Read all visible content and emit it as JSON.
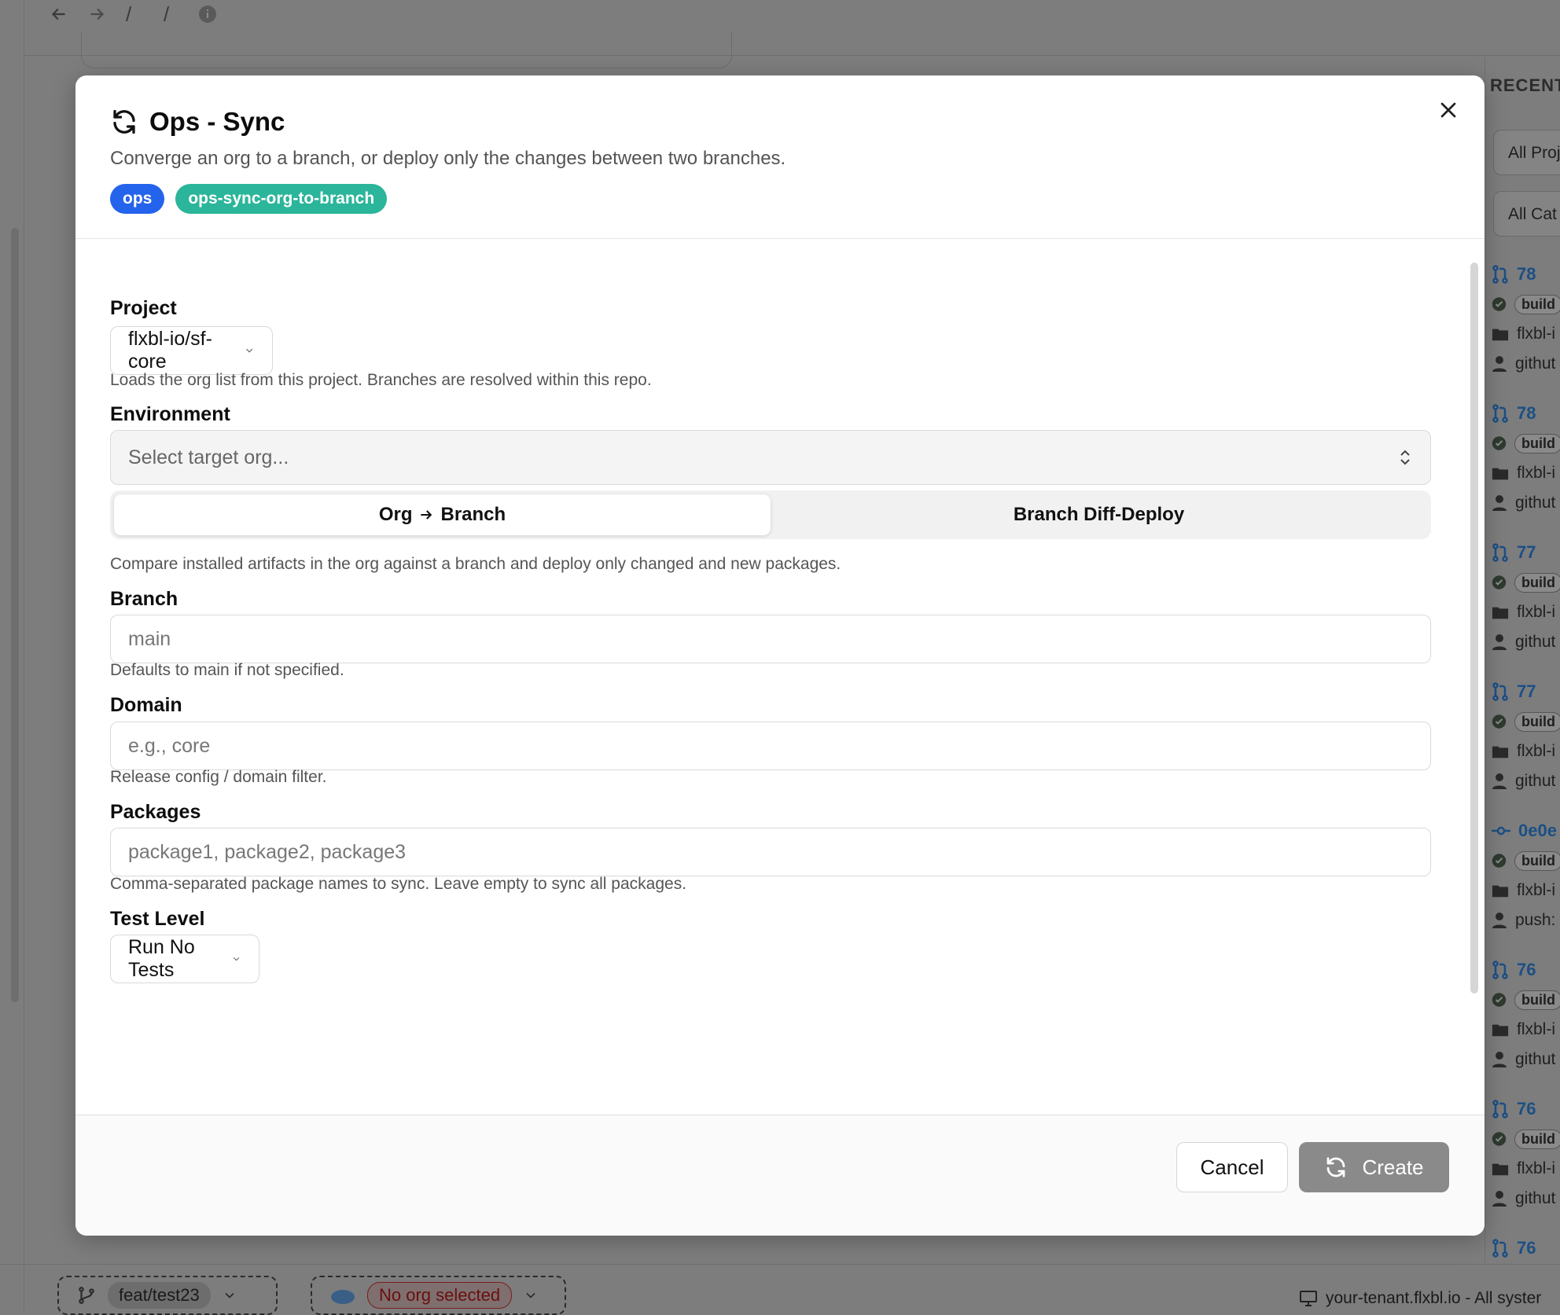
{
  "background": {
    "nav": {
      "back_icon": "arrow-left-icon",
      "forward_icon": "arrow-right-icon",
      "sep1": "/",
      "sep2": "/",
      "info_icon": "info-icon"
    },
    "right_panel": {
      "heading": "RECENT",
      "filter_projects": "All Proj",
      "filter_categories": "All Cat",
      "items": [
        {
          "number": "78",
          "badge": "build",
          "repo": "flxbl-i",
          "user": "githut",
          "kind": "pr"
        },
        {
          "number": "78",
          "badge": "build",
          "repo": "flxbl-i",
          "user": "githut",
          "kind": "pr"
        },
        {
          "number": "77",
          "badge": "build",
          "repo": "flxbl-i",
          "user": "githut",
          "kind": "pr"
        },
        {
          "number": "77",
          "badge": "build",
          "repo": "flxbl-i",
          "user": "githut",
          "kind": "pr"
        },
        {
          "number": "0e0e",
          "badge": "build",
          "repo": "flxbl-i",
          "user": "push:",
          "kind": "commit"
        },
        {
          "number": "76",
          "badge": "build",
          "repo": "flxbl-i",
          "user": "githut",
          "kind": "pr"
        },
        {
          "number": "76",
          "badge": "build",
          "repo": "flxbl-i",
          "user": "githut",
          "kind": "pr"
        },
        {
          "number": "76",
          "badge": "",
          "repo": "",
          "user": "",
          "kind": "pr"
        }
      ]
    },
    "bottom": {
      "branch": "feat/test23",
      "org": "No org selected",
      "tenant": "your-tenant.flxbl.io - All syster"
    }
  },
  "modal": {
    "title": "Ops - Sync",
    "subtitle": "Converge an org to a branch, or deploy only the changes between two branches.",
    "tags": [
      "ops",
      "ops-sync-org-to-branch"
    ],
    "colors": {
      "tag_ops": "#2463eb",
      "tag_slug": "#2bb59a",
      "create_button": "#8a8a8a"
    },
    "project": {
      "label": "Project",
      "value": "flxbl-io/sf-core",
      "help": "Loads the org list from this project. Branches are resolved within this repo."
    },
    "environment": {
      "label": "Environment",
      "placeholder": "Select target org..."
    },
    "tabs": {
      "org_to_branch_left": "Org",
      "org_to_branch_right": "Branch",
      "branch_diff": "Branch Diff-Deploy",
      "active": "Org → Branch"
    },
    "mode_description": "Compare installed artifacts in the org against a branch and deploy only changed and new packages.",
    "branch": {
      "label": "Branch",
      "placeholder": "main",
      "help": "Defaults to main if not specified."
    },
    "domain": {
      "label": "Domain",
      "placeholder": "e.g., core",
      "help": "Release config / domain filter."
    },
    "packages": {
      "label": "Packages",
      "placeholder": "package1, package2, package3",
      "help": "Comma-separated package names to sync. Leave empty to sync all packages."
    },
    "test_level": {
      "label": "Test Level",
      "value": "Run No Tests"
    },
    "footer": {
      "cancel": "Cancel",
      "create": "Create"
    }
  }
}
